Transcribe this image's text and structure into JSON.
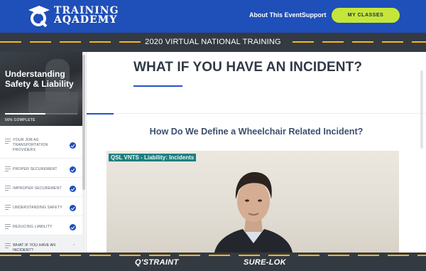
{
  "header": {
    "logo_line1": "TRAINING",
    "logo_line2": "AQADEMY",
    "nav": [
      {
        "label": "About This Event"
      },
      {
        "label": "Support"
      }
    ],
    "cta_label": "MY CLASSES",
    "colors": {
      "header_bg": "#1f4fb8",
      "cta_bg": "#c4e63a"
    }
  },
  "banner": {
    "title": "2020 VIRTUAL NATIONAL TRAINING"
  },
  "sidebar": {
    "course_title": "Understanding Safety & Liability",
    "progress_percent": 56,
    "progress_label": "56% COMPLETE",
    "lessons": [
      {
        "label": "YOUR JOB AS TRANSPORTATION PROVIDERS",
        "completed": true
      },
      {
        "label": "PROPER SECUREMENT",
        "completed": true
      },
      {
        "label": "IMPROPER SECUREMENT",
        "completed": true
      },
      {
        "label": "UNDERSTANDING SAFETY",
        "completed": true
      },
      {
        "label": "REDUCING LIABILITY",
        "completed": true
      },
      {
        "label": "WHAT IF YOU HAVE AN INCIDENT?",
        "completed": false,
        "active": true
      }
    ]
  },
  "main": {
    "title": "WHAT IF YOU HAVE AN INCIDENT?",
    "subheading": "How Do We Define a Wheelchair Related Incident?",
    "video_caption": "QSL VNTS - Liability: Incidents"
  },
  "footer": {
    "brand_left": "Q'STRAINT",
    "brand_right": "SURE-LOK"
  }
}
